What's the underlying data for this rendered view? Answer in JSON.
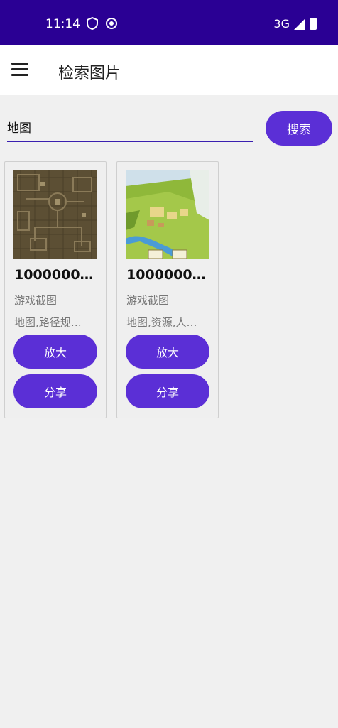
{
  "status_bar": {
    "time": "11:14",
    "network": "3G"
  },
  "app_bar": {
    "title": "检索图片"
  },
  "search": {
    "value": "地图",
    "button_label": "搜索"
  },
  "results": [
    {
      "title": "1000000…",
      "type": "游戏截图",
      "tags": "地图,路径规…",
      "zoom_label": "放大",
      "share_label": "分享"
    },
    {
      "title": "1000000…",
      "type": "游戏截图",
      "tags": "地图,资源,人…",
      "zoom_label": "放大",
      "share_label": "分享"
    }
  ],
  "colors": {
    "status_bar": "#2a0094",
    "accent": "#5b2fd6",
    "background": "#f0f0f0"
  }
}
